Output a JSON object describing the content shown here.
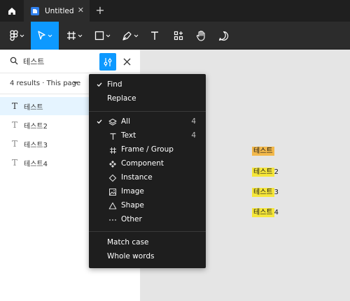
{
  "tab": {
    "title": "Untitled"
  },
  "search": {
    "query": "테스트"
  },
  "results": {
    "summary": "4 results · This page",
    "items": [
      {
        "label": "테스트"
      },
      {
        "label": "테스트2"
      },
      {
        "label": "테스트3"
      },
      {
        "label": "테스트4"
      }
    ]
  },
  "menu": {
    "find": "Find",
    "replace": "Replace",
    "all": {
      "label": "All",
      "count": "4"
    },
    "text": {
      "label": "Text",
      "count": "4"
    },
    "frame": "Frame / Group",
    "component": "Component",
    "instance": "Instance",
    "image": "Image",
    "shape": "Shape",
    "other": "Other",
    "match_case": "Match case",
    "whole_words": "Whole words"
  },
  "canvas": {
    "items": [
      {
        "mark": "테스트",
        "suffix": ""
      },
      {
        "mark": "테스트",
        "suffix": "2"
      },
      {
        "mark": "테스트",
        "suffix": "3"
      },
      {
        "mark": "테스트",
        "suffix": "4"
      }
    ]
  },
  "colors": {
    "accent": "#0d99ff",
    "highlight": "#f5e63a",
    "current_highlight": "#f2b84b"
  }
}
